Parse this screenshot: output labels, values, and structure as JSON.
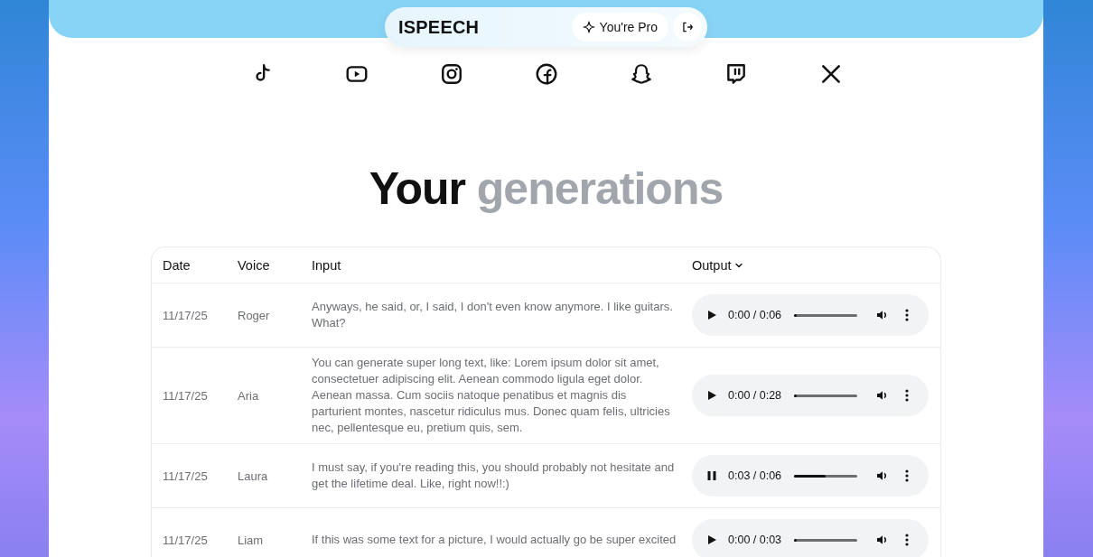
{
  "nav": {
    "brand": "ISPEECH",
    "pro_label": "You're Pro"
  },
  "title": {
    "lead": "Your",
    "accent": "generations"
  },
  "table": {
    "columns": [
      "Date",
      "Voice",
      "Input",
      "Output"
    ],
    "rows": [
      {
        "date": "11/17/25",
        "voice": "Roger",
        "input": "Anyways, he said, or, I said, I don't even know anymore. I like guitars. What?",
        "time": "0:00 / 0:06",
        "playing": false,
        "level": 0
      },
      {
        "date": "11/17/25",
        "voice": "Aria",
        "input": "You can generate super long text, like: Lorem ipsum dolor sit amet, consectetuer adipiscing elit. Aenean commodo ligula eget dolor. Aenean massa. Cum sociis natoque penatibus et magnis dis parturient montes, nascetur ridiculus mus. Donec quam felis, ultricies nec, pellentesque eu, pretium quis, sem.",
        "time": "0:00 / 0:28",
        "playing": false,
        "level": 0
      },
      {
        "date": "11/17/25",
        "voice": "Laura",
        "input": "I must say, if you're reading this, you should probably not hesitate and get the lifetime deal. Like, right now!!:)",
        "time": "0:03 / 0:06",
        "playing": true,
        "level": 0.5
      },
      {
        "date": "11/17/25",
        "voice": "Liam",
        "input": "If this was some text for a picture, I would actually go be super excited",
        "time": "0:00 / 0:03",
        "playing": false,
        "level": 0
      }
    ]
  }
}
